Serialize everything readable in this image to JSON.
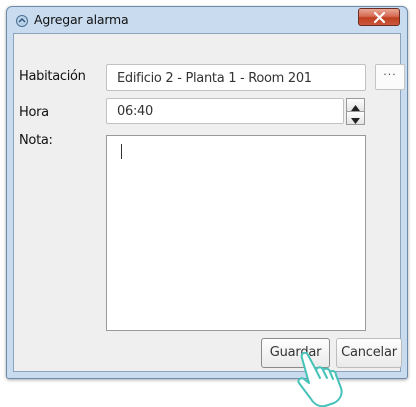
{
  "window": {
    "title": "Agregar alarma",
    "close_icon": "close-icon",
    "app_icon": "alarm-app-icon"
  },
  "form": {
    "room": {
      "label": "Habitación",
      "value": "Edificio 2 - Planta 1 - Room 201",
      "browse_label": "···"
    },
    "time": {
      "label": "Hora",
      "value": "06:40"
    },
    "note": {
      "label": "Nota:",
      "value": ""
    }
  },
  "buttons": {
    "save": "Guardar",
    "cancel": "Cancelar"
  },
  "colors": {
    "frame": "#c9dcef",
    "close": "#c0401f",
    "client_bg": "#efefef"
  }
}
